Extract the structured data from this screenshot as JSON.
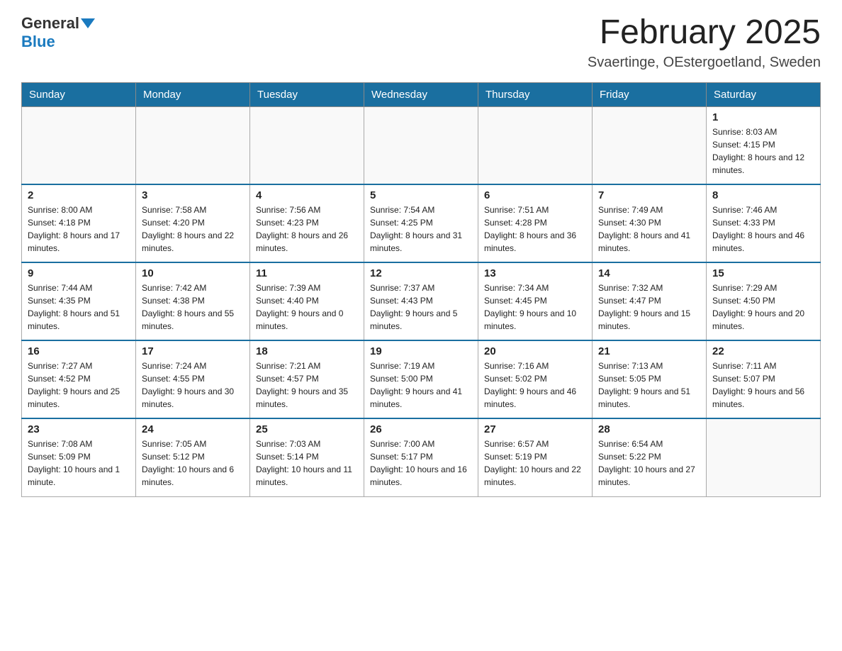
{
  "header": {
    "logo": {
      "general": "General",
      "blue": "Blue"
    },
    "title": "February 2025",
    "location": "Svaertinge, OEstergoetland, Sweden"
  },
  "days_of_week": [
    "Sunday",
    "Monday",
    "Tuesday",
    "Wednesday",
    "Thursday",
    "Friday",
    "Saturday"
  ],
  "weeks": [
    {
      "days": [
        {
          "number": "",
          "info": ""
        },
        {
          "number": "",
          "info": ""
        },
        {
          "number": "",
          "info": ""
        },
        {
          "number": "",
          "info": ""
        },
        {
          "number": "",
          "info": ""
        },
        {
          "number": "",
          "info": ""
        },
        {
          "number": "1",
          "info": "Sunrise: 8:03 AM\nSunset: 4:15 PM\nDaylight: 8 hours and 12 minutes."
        }
      ]
    },
    {
      "days": [
        {
          "number": "2",
          "info": "Sunrise: 8:00 AM\nSunset: 4:18 PM\nDaylight: 8 hours and 17 minutes."
        },
        {
          "number": "3",
          "info": "Sunrise: 7:58 AM\nSunset: 4:20 PM\nDaylight: 8 hours and 22 minutes."
        },
        {
          "number": "4",
          "info": "Sunrise: 7:56 AM\nSunset: 4:23 PM\nDaylight: 8 hours and 26 minutes."
        },
        {
          "number": "5",
          "info": "Sunrise: 7:54 AM\nSunset: 4:25 PM\nDaylight: 8 hours and 31 minutes."
        },
        {
          "number": "6",
          "info": "Sunrise: 7:51 AM\nSunset: 4:28 PM\nDaylight: 8 hours and 36 minutes."
        },
        {
          "number": "7",
          "info": "Sunrise: 7:49 AM\nSunset: 4:30 PM\nDaylight: 8 hours and 41 minutes."
        },
        {
          "number": "8",
          "info": "Sunrise: 7:46 AM\nSunset: 4:33 PM\nDaylight: 8 hours and 46 minutes."
        }
      ]
    },
    {
      "days": [
        {
          "number": "9",
          "info": "Sunrise: 7:44 AM\nSunset: 4:35 PM\nDaylight: 8 hours and 51 minutes."
        },
        {
          "number": "10",
          "info": "Sunrise: 7:42 AM\nSunset: 4:38 PM\nDaylight: 8 hours and 55 minutes."
        },
        {
          "number": "11",
          "info": "Sunrise: 7:39 AM\nSunset: 4:40 PM\nDaylight: 9 hours and 0 minutes."
        },
        {
          "number": "12",
          "info": "Sunrise: 7:37 AM\nSunset: 4:43 PM\nDaylight: 9 hours and 5 minutes."
        },
        {
          "number": "13",
          "info": "Sunrise: 7:34 AM\nSunset: 4:45 PM\nDaylight: 9 hours and 10 minutes."
        },
        {
          "number": "14",
          "info": "Sunrise: 7:32 AM\nSunset: 4:47 PM\nDaylight: 9 hours and 15 minutes."
        },
        {
          "number": "15",
          "info": "Sunrise: 7:29 AM\nSunset: 4:50 PM\nDaylight: 9 hours and 20 minutes."
        }
      ]
    },
    {
      "days": [
        {
          "number": "16",
          "info": "Sunrise: 7:27 AM\nSunset: 4:52 PM\nDaylight: 9 hours and 25 minutes."
        },
        {
          "number": "17",
          "info": "Sunrise: 7:24 AM\nSunset: 4:55 PM\nDaylight: 9 hours and 30 minutes."
        },
        {
          "number": "18",
          "info": "Sunrise: 7:21 AM\nSunset: 4:57 PM\nDaylight: 9 hours and 35 minutes."
        },
        {
          "number": "19",
          "info": "Sunrise: 7:19 AM\nSunset: 5:00 PM\nDaylight: 9 hours and 41 minutes."
        },
        {
          "number": "20",
          "info": "Sunrise: 7:16 AM\nSunset: 5:02 PM\nDaylight: 9 hours and 46 minutes."
        },
        {
          "number": "21",
          "info": "Sunrise: 7:13 AM\nSunset: 5:05 PM\nDaylight: 9 hours and 51 minutes."
        },
        {
          "number": "22",
          "info": "Sunrise: 7:11 AM\nSunset: 5:07 PM\nDaylight: 9 hours and 56 minutes."
        }
      ]
    },
    {
      "days": [
        {
          "number": "23",
          "info": "Sunrise: 7:08 AM\nSunset: 5:09 PM\nDaylight: 10 hours and 1 minute."
        },
        {
          "number": "24",
          "info": "Sunrise: 7:05 AM\nSunset: 5:12 PM\nDaylight: 10 hours and 6 minutes."
        },
        {
          "number": "25",
          "info": "Sunrise: 7:03 AM\nSunset: 5:14 PM\nDaylight: 10 hours and 11 minutes."
        },
        {
          "number": "26",
          "info": "Sunrise: 7:00 AM\nSunset: 5:17 PM\nDaylight: 10 hours and 16 minutes."
        },
        {
          "number": "27",
          "info": "Sunrise: 6:57 AM\nSunset: 5:19 PM\nDaylight: 10 hours and 22 minutes."
        },
        {
          "number": "28",
          "info": "Sunrise: 6:54 AM\nSunset: 5:22 PM\nDaylight: 10 hours and 27 minutes."
        },
        {
          "number": "",
          "info": ""
        }
      ]
    }
  ]
}
